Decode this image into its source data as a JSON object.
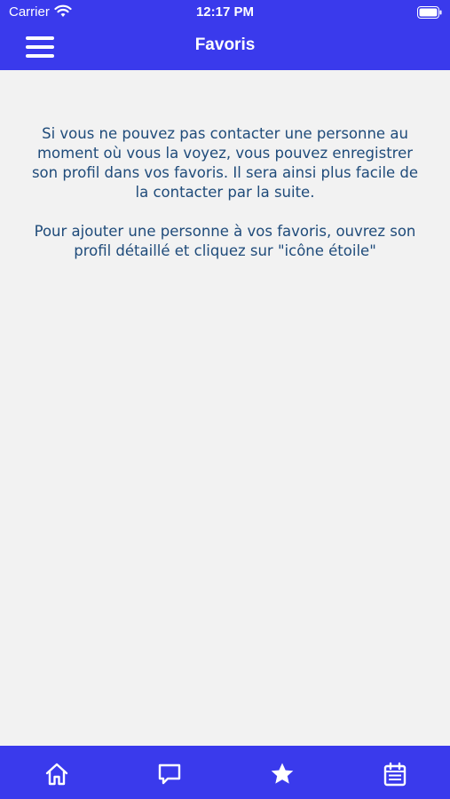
{
  "status_bar": {
    "carrier": "Carrier",
    "time": "12:17 PM",
    "icons": [
      "wifi-icon",
      "battery-icon"
    ]
  },
  "header": {
    "title": "Favoris",
    "menu_icon": "hamburger-menu-icon"
  },
  "main": {
    "paragraphs": [
      "Si vous ne pouvez pas contacter une personne au moment où vous la voyez, vous pouvez enregistrer son profil dans vos favoris. Il sera ainsi plus facile de la contacter par la suite.",
      "Pour ajouter une personne à vos favoris, ouvrez son profil détaillé et cliquez sur \"icône étoile\""
    ]
  },
  "tabbar": {
    "items": [
      {
        "icon": "home-icon"
      },
      {
        "icon": "chat-icon"
      },
      {
        "icon": "star-icon"
      },
      {
        "icon": "calendar-icon"
      }
    ]
  },
  "colors": {
    "brand": "#3a3aec",
    "background": "#f2f2f2",
    "text": "#1f4b7a"
  }
}
